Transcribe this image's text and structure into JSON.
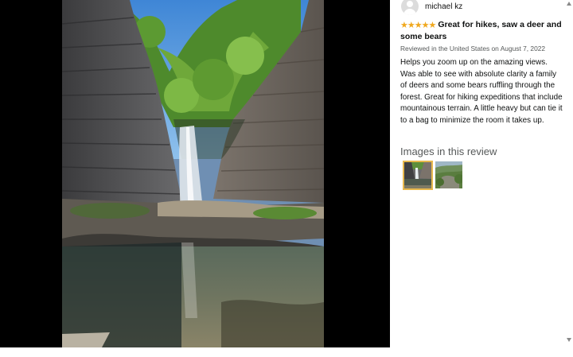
{
  "review": {
    "reviewer_name": "michael kz",
    "rating_stars": 5,
    "title": "Great for hikes, saw a deer and some bears",
    "meta": "Reviewed in the United States on August 7, 2022",
    "body": "Helps you zoom up on the amazing views. Was able to see with absolute clarity a family of deers and some bears ruffling through the forest. Great for hiking expeditions that include mountainous terrain. A little heavy but can tie it to a bag to minimize the room it takes up.",
    "images_heading": "Images in this review",
    "star_color": "#f0a81e"
  },
  "viewer": {
    "photo_subject": "waterfall into pool between rock cliffs",
    "background": "#000000"
  },
  "thumbnails": [
    {
      "subject": "waterfall photo",
      "selected": true
    },
    {
      "subject": "landscape view photo",
      "selected": false
    }
  ],
  "icons": {
    "avatar": "user-avatar-icon",
    "star": "star-icon",
    "scroll_up": "scroll-up-arrow-icon",
    "scroll_down": "scroll-down-arrow-icon"
  }
}
